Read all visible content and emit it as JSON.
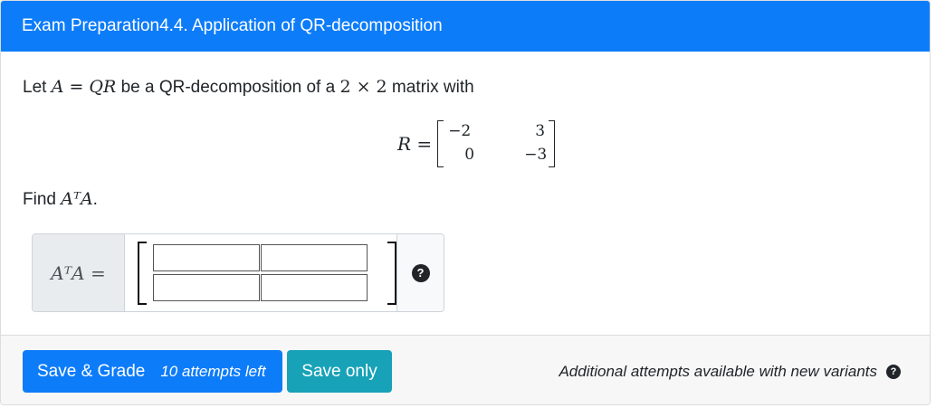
{
  "header": {
    "title": "Exam Preparation4.4. Application of QR-decomposition"
  },
  "question": {
    "prompt_prefix": "Let ",
    "prompt_math1": "A = QR",
    "prompt_mid": " be a QR-decomposition of a ",
    "prompt_math2": "2 × 2",
    "prompt_suffix": " matrix with",
    "r_lhs": "R =",
    "r_matrix": [
      [
        "−2",
        "3"
      ],
      [
        "0",
        "−3"
      ]
    ],
    "find_prefix": "Find ",
    "find_math": "AᵀA",
    "find_suffix": "."
  },
  "answer": {
    "label": "AᵀA =",
    "cells": [
      [
        "",
        ""
      ],
      [
        "",
        ""
      ]
    ],
    "help_icon": "question-circle-icon"
  },
  "footer": {
    "save_grade_label": "Save & Grade",
    "attempts_left": "10 attempts left",
    "save_only_label": "Save only",
    "additional_note": "Additional attempts available with new variants",
    "colors": {
      "primary": "#0d7cf9",
      "info": "#17a2b8"
    }
  }
}
